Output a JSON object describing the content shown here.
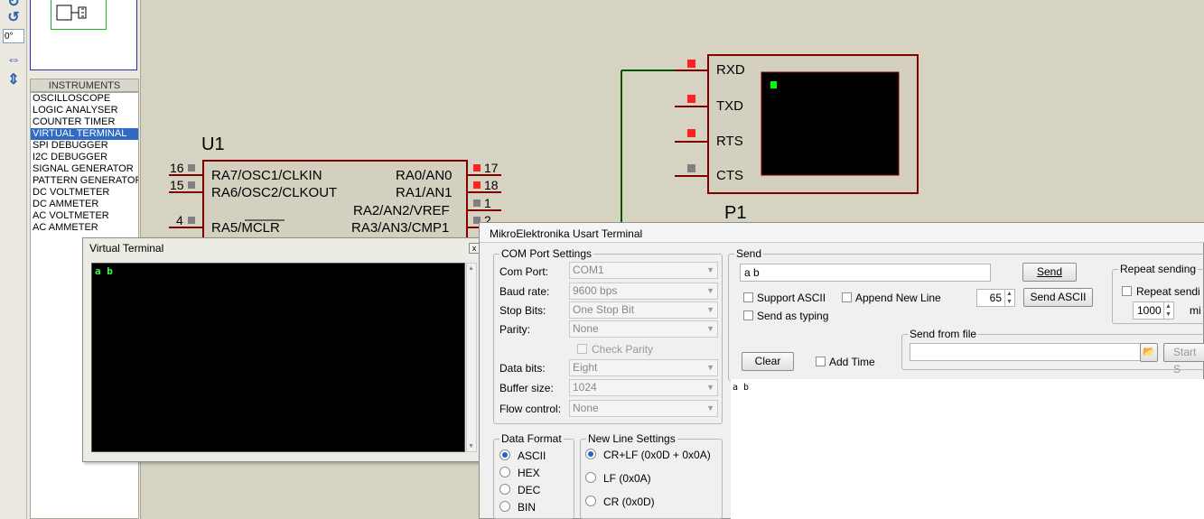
{
  "toolstrip": {
    "rotation_value": "0°",
    "icons": [
      "rotate-cw-icon",
      "rotate-ccw-icon",
      "mirror-horizontal-icon",
      "mirror-vertical-icon"
    ]
  },
  "instruments": {
    "header": "INSTRUMENTS",
    "items": [
      "OSCILLOSCOPE",
      "LOGIC ANALYSER",
      "COUNTER TIMER",
      "VIRTUAL TERMINAL",
      "SPI DEBUGGER",
      "I2C DEBUGGER",
      "SIGNAL GENERATOR",
      "PATTERN GENERATOR",
      "DC VOLTMETER",
      "DC AMMETER",
      "AC VOLTMETER",
      "AC AMMETER"
    ],
    "selected": "VIRTUAL TERMINAL"
  },
  "schematic": {
    "u1_label": "U1",
    "u1_pins_left": [
      {
        "num": "16",
        "name": "RA7/OSC1/CLKIN"
      },
      {
        "num": "15",
        "name": "RA6/OSC2/CLKOUT"
      },
      {
        "num": "4",
        "name": "RA5/MCLR"
      }
    ],
    "u1_pins_right": [
      {
        "num": "17",
        "name": "RA0/AN0"
      },
      {
        "num": "18",
        "name": "RA1/AN1"
      },
      {
        "num": "1",
        "name": "RA2/AN2/VREF"
      },
      {
        "num": "2",
        "name": "RA3/AN3/CMP1"
      }
    ],
    "p1_label": "P1",
    "terminal_pins": [
      "RXD",
      "TXD",
      "RTS",
      "CTS"
    ],
    "colors": {
      "wire": "#800000",
      "net": "#005500",
      "pin_active": "#ff2020",
      "pin_inactive": "#808080",
      "chip_fill": "#d4d0bf",
      "terminal_cursor": "#00ff00"
    }
  },
  "virtual_terminal": {
    "title": "Virtual Terminal",
    "content": "a b"
  },
  "usart": {
    "title": "MikroElektronika Usart Terminal",
    "com": {
      "legend": "COM Port Settings",
      "fields": [
        {
          "label": "Com Port:",
          "value": "COM1"
        },
        {
          "label": "Baud rate:",
          "value": "9600 bps"
        },
        {
          "label": "Stop Bits:",
          "value": "One Stop Bit"
        },
        {
          "label": "Parity:",
          "value": "None"
        }
      ],
      "check_parity": "Check Parity",
      "fields2": [
        {
          "label": "Data bits:",
          "value": "Eight"
        },
        {
          "label": "Buffer size:",
          "value": "1024"
        },
        {
          "label": "Flow control:",
          "value": "None"
        }
      ]
    },
    "data_format": {
      "legend": "Data Format",
      "options": [
        "ASCII",
        "HEX",
        "DEC",
        "BIN"
      ],
      "selected": "ASCII"
    },
    "new_line": {
      "legend": "New Line Settings",
      "options": [
        "CR+LF (0x0D + 0x0A)",
        "LF (0x0A)",
        "CR (0x0D)"
      ],
      "selected": "CR+LF (0x0D + 0x0A)"
    },
    "send": {
      "legend": "Send",
      "input_value": "a b",
      "send_button": "Send",
      "support_ascii": "Support ASCII",
      "append_new_line": "Append New Line",
      "ascii_value": "65",
      "send_ascii_button": "Send ASCII",
      "send_as_typing": "Send as typing",
      "send_from_file_legend": "Send from file",
      "start_button": "Start S",
      "clear_button": "Clear",
      "add_time": "Add Time"
    },
    "repeat": {
      "legend": "Repeat sending",
      "checkbox": "Repeat sendi",
      "interval_value": "1000",
      "unit": "mi"
    },
    "received": "a b"
  }
}
